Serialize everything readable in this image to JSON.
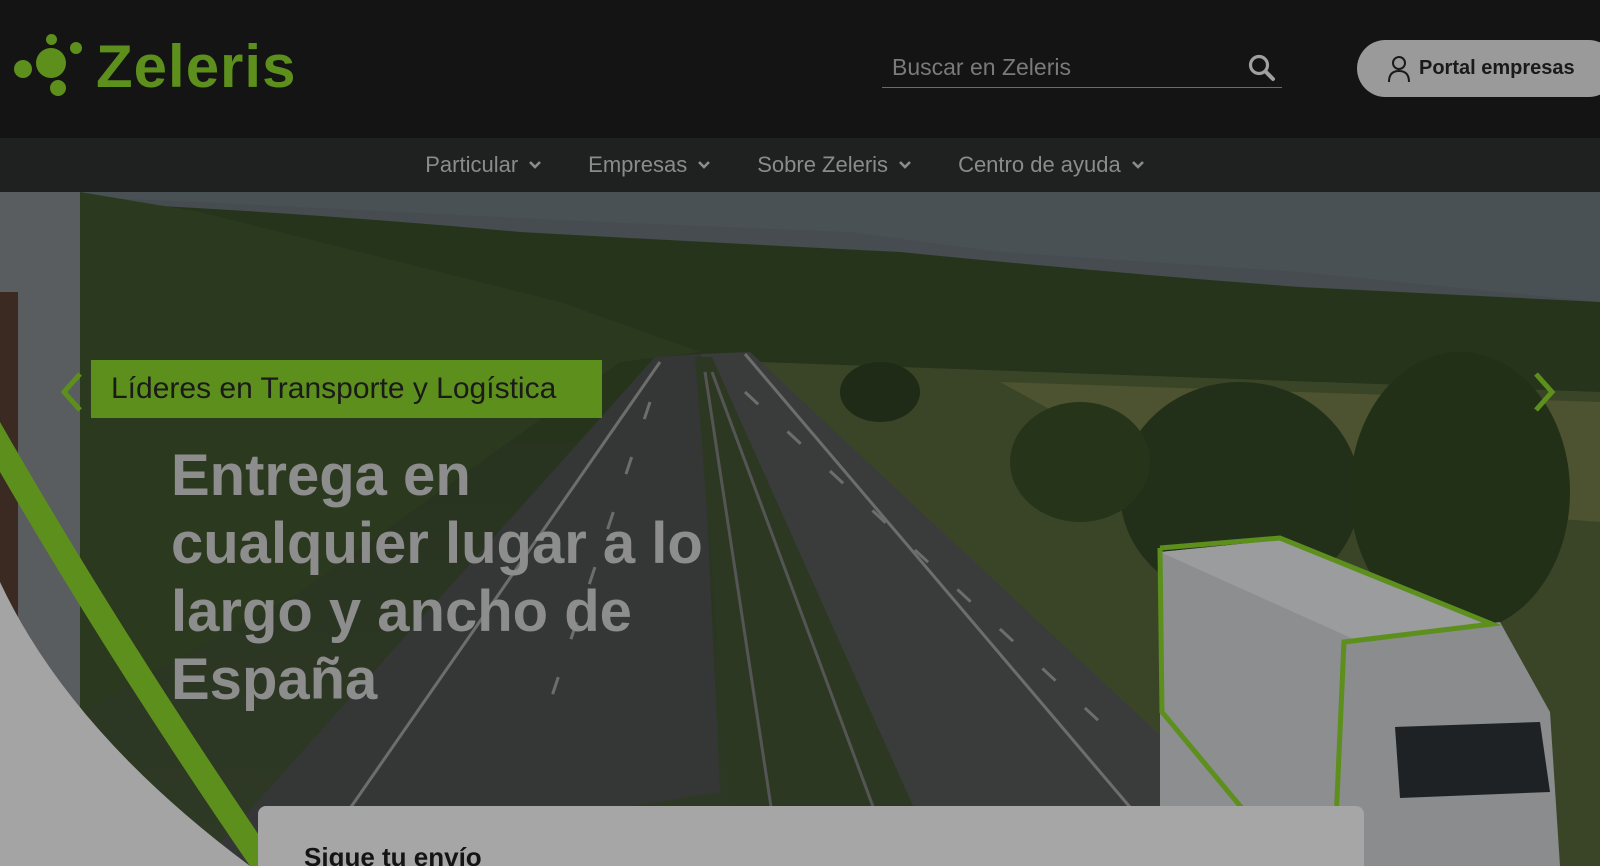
{
  "brand": {
    "name": "Zeleris",
    "color": "#5d8f1c"
  },
  "search": {
    "placeholder": "Buscar en Zeleris",
    "icon": "search-icon"
  },
  "portal": {
    "label": "Portal empresas",
    "icon": "user-icon"
  },
  "nav": {
    "items": [
      {
        "label": "Particular"
      },
      {
        "label": "Empresas"
      },
      {
        "label": "Sobre Zeleris"
      },
      {
        "label": "Centro de ayuda"
      }
    ]
  },
  "hero": {
    "tagline": "Líderes en Transporte y Logística",
    "headline": "Entrega en cualquier lugar a lo largo y ancho de España"
  },
  "tracking": {
    "title": "Sigue tu envío"
  }
}
